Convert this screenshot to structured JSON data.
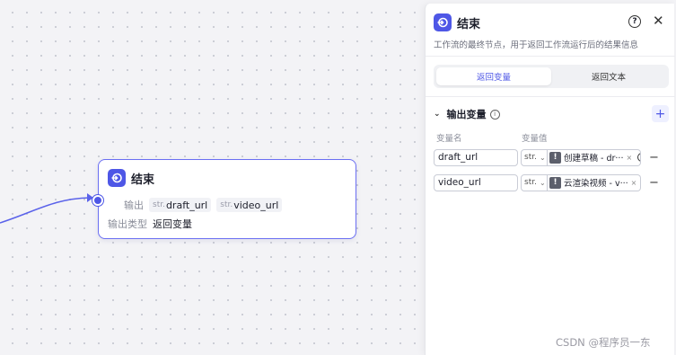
{
  "node": {
    "title": "结束",
    "output_label": "输出",
    "output_vars": [
      {
        "prefix": "str.",
        "name": "draft_url"
      },
      {
        "prefix": "str.",
        "name": "video_url"
      }
    ],
    "output_type_label": "输出类型",
    "output_type_value": "返回变量"
  },
  "panel": {
    "title": "结束",
    "help_glyph": "?",
    "close_glyph": "✕",
    "description": "工作流的最终节点，用于返回工作流运行后的结果信息",
    "tabs": [
      {
        "label": "返回变量",
        "active": true
      },
      {
        "label": "返回文本",
        "active": false
      }
    ],
    "section_title": "输出变量",
    "info_glyph": "i",
    "add_glyph": "+",
    "col_name": "变量名",
    "col_value": "变量值",
    "rows": [
      {
        "name": "draft_url",
        "type": "str.",
        "ref": "创建草稿 - dr···"
      },
      {
        "name": "video_url",
        "type": "str.",
        "ref": "云渲染视频 - v···"
      }
    ],
    "warn_glyph": "!",
    "remove_glyph": "×",
    "minus_glyph": "−"
  },
  "watermark": "CSDN @程序员一东",
  "colors": {
    "accent": "#4e57e6",
    "border": "#6b6ff2"
  }
}
